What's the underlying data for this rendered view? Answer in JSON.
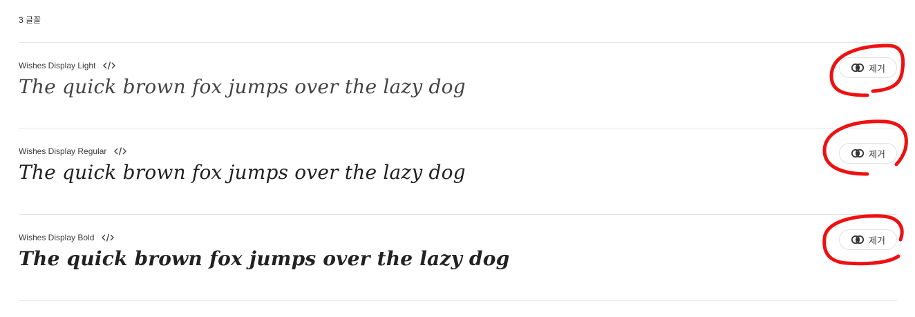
{
  "header": {
    "font_count": "3 글꼴"
  },
  "fonts": [
    {
      "name": "Wishes Display Light",
      "sample": "The quick brown fox jumps over the lazy dog",
      "remove_label": "제거"
    },
    {
      "name": "Wishes Display Regular",
      "sample": "The quick brown fox jumps over the lazy dog",
      "remove_label": "제거"
    },
    {
      "name": "Wishes Display Bold",
      "sample": "The quick brown fox jumps over the lazy dog",
      "remove_label": "제거"
    }
  ],
  "icons": {
    "embed": "code-icon",
    "creative_cloud": "creative-cloud-icon"
  },
  "colors": {
    "annotation": "#ee1111",
    "divider": "#e4e4e4",
    "button_border": "#e1e1e1"
  }
}
